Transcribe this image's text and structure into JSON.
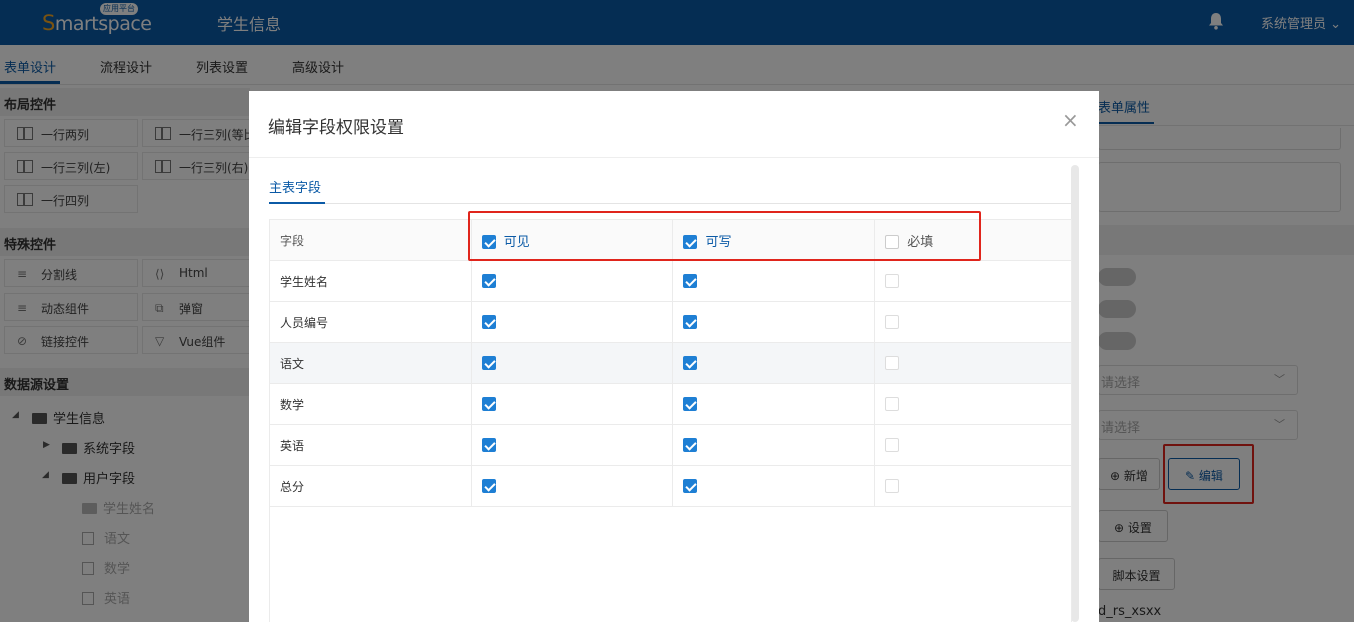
{
  "header": {
    "logo": "Smartspace",
    "logo_badge": "应用平台",
    "title": "学生信息",
    "user": "系统管理员"
  },
  "tabs": [
    "表单设计",
    "流程设计",
    "列表设置",
    "高级设计"
  ],
  "sidebar": {
    "layout_title": "布局控件",
    "layout_items": [
      "一行两列",
      "一行三列(等比",
      "一行三列(左)",
      "一行三列(右)",
      "一行四列"
    ],
    "special_title": "特殊控件",
    "special_items": [
      "分割线",
      "Html",
      "动态组件",
      "弹窗",
      "链接控件",
      "Vue组件"
    ],
    "datasource_title": "数据源设置",
    "tree": {
      "root": "学生信息",
      "sys": "系统字段",
      "user": "用户字段",
      "children": [
        "学生姓名",
        "语文",
        "数学",
        "英语"
      ]
    }
  },
  "right_panel": {
    "tab": "表单属性",
    "select_placeholder": "请选择",
    "add_label": "新增",
    "edit_label": "编辑",
    "settings_label": "设置",
    "script_label": "脚本设置",
    "table_name": "d_rs_xsxx"
  },
  "modal": {
    "title": "编辑字段权限设置",
    "tab": "主表字段",
    "columns": {
      "field": "字段",
      "visible": "可见",
      "writable": "可写",
      "required": "必填"
    },
    "header_checks": {
      "visible": true,
      "writable": true,
      "required": false
    },
    "rows": [
      {
        "name": "学生姓名",
        "visible": true,
        "writable": true,
        "required": false
      },
      {
        "name": "人员编号",
        "visible": true,
        "writable": true,
        "required": false
      },
      {
        "name": "语文",
        "visible": true,
        "writable": true,
        "required": false
      },
      {
        "name": "数学",
        "visible": true,
        "writable": true,
        "required": false
      },
      {
        "name": "英语",
        "visible": true,
        "writable": true,
        "required": false
      },
      {
        "name": "总分",
        "visible": true,
        "writable": true,
        "required": false
      }
    ]
  },
  "colors": {
    "primary": "#0b5aa6",
    "checkbox": "#1e7fd4",
    "highlight": "#e0251c"
  },
  "icons": [
    "bell-icon",
    "chevron-down-icon",
    "close-icon",
    "folder-icon",
    "edit-icon",
    "plus-circle-icon"
  ]
}
